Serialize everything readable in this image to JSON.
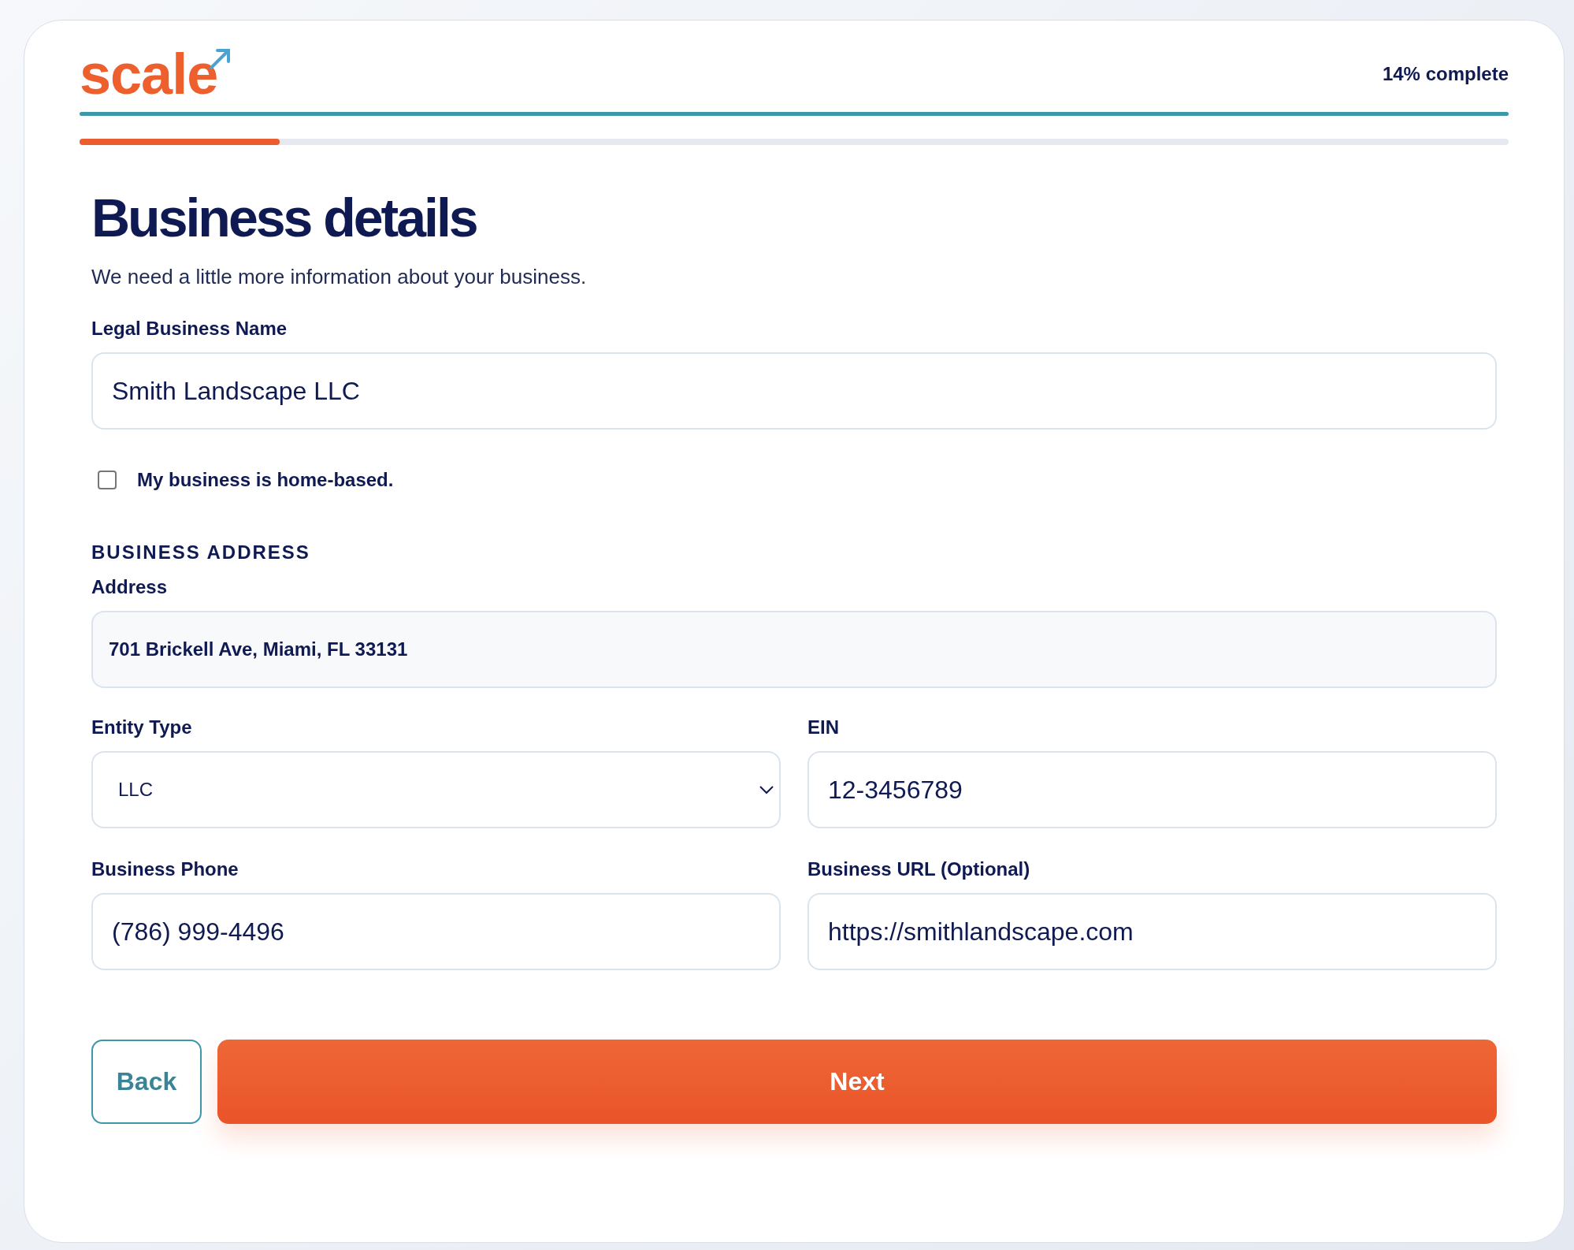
{
  "header": {
    "logo": "scale",
    "progress_label": "14% complete",
    "progress": {
      "level": 0.14
    }
  },
  "title": "Business details",
  "subtitle": "We need a little more information about your business.",
  "name_field": {
    "label": "Legal Business Name",
    "value": "Smith Landscape LLC",
    "kind": "text"
  },
  "home_based": {
    "label": "My business is home-based.",
    "checked": false
  },
  "section_heading": "BUSINESS ADDRESS",
  "address_field": {
    "label": "Address",
    "value": "701 Brickell Ave, Miami, FL 33131",
    "kind": "readonly"
  },
  "grid_fields": [
    {
      "label": "Entity Type",
      "value": "LLC",
      "kind": "select"
    },
    {
      "label": "EIN",
      "value": "12-3456789",
      "kind": "text"
    },
    {
      "label": "Business Phone",
      "value": "(786) 999-4496",
      "kind": "text"
    },
    {
      "label": "Business URL (Optional)",
      "value": "https://smithlandscape.com",
      "kind": "text"
    }
  ],
  "buttons": {
    "back": "Back",
    "next": "Next"
  }
}
